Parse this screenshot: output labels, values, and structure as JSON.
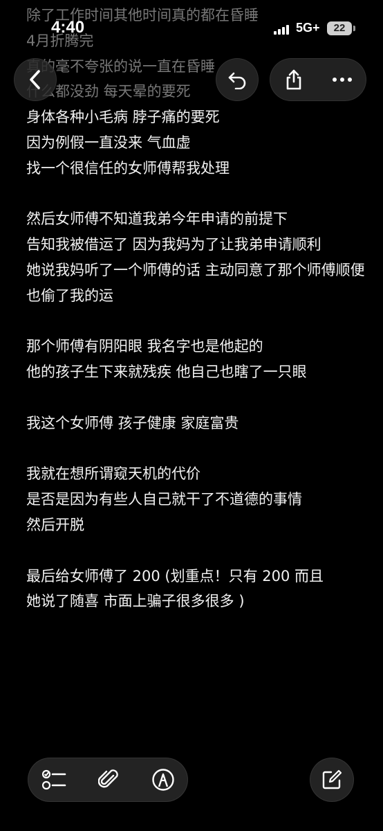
{
  "status_bar": {
    "time": "4:40",
    "network": "5G+",
    "battery": "22"
  },
  "note": {
    "lines": [
      "除了工作时间其他时间真的都在昏睡",
      "4月折腾完",
      "真的毫不夸张的说一直在昏睡",
      "什么都没劲 每天晕的要死",
      "身体各种小毛病 脖子痛的要死",
      "因为例假一直没来 气血虚",
      "找一个很信任的女师傅帮我处理",
      "",
      "然后女师傅不知道我弟今年申请的前提下",
      "告知我被借运了 因为我妈为了让我弟申请顺利",
      "她说我妈听了一个师傅的话 主动同意了那个师傅顺便也偷了我的运",
      "",
      "那个师傅有阴阳眼 我名字也是他起的",
      "他的孩子生下来就残疾 他自己也瞎了一只眼",
      "",
      "我这个女师傅 孩子健康 家庭富贵",
      "",
      "我就在想所谓窥天机的代价",
      "是否是因为有些人自己就干了不道德的事情",
      "然后开脱",
      "",
      "最后给女师傅了 200 (划重点！只有 200 而且",
      "她说了随喜 市面上骗子很多很多 )"
    ]
  },
  "icons": {
    "back": "chevron-left-icon",
    "undo": "undo-icon",
    "share": "share-icon",
    "more": "more-icon",
    "checklist": "checklist-icon",
    "attachment": "paperclip-icon",
    "markup": "pen-markup-icon",
    "compose": "compose-icon"
  }
}
